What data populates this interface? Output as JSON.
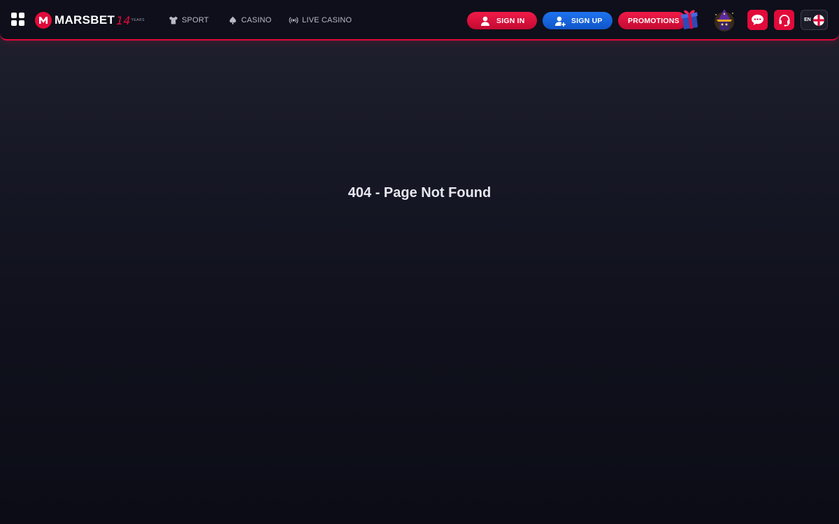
{
  "header": {
    "logo": {
      "brand": "MARSBET",
      "years_number": "14",
      "years_label": "YEARS"
    },
    "nav": [
      {
        "label": "SPORT",
        "icon": "jersey-icon"
      },
      {
        "label": "CASINO",
        "icon": "spade-icon"
      },
      {
        "label": "LIVE CASINO",
        "icon": "broadcast-icon"
      }
    ],
    "buttons": {
      "sign_in": "SIGN IN",
      "sign_up": "SIGN UP",
      "promotions": "PROMOTIONS"
    },
    "language": "EN"
  },
  "main": {
    "message": "404 - Page Not Found"
  },
  "colors": {
    "accent_red": "#e10a3a",
    "accent_blue": "#1a66e0",
    "background": "#171826"
  }
}
